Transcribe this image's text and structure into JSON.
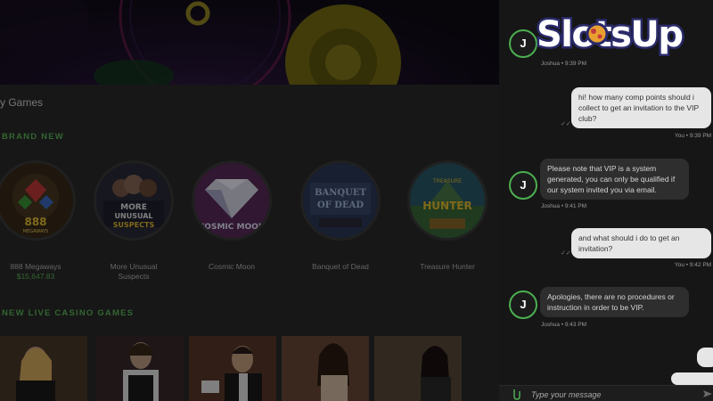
{
  "casino": {
    "section_title": "y Games",
    "brand_new_label": "BRAND NEW",
    "live_label": "NEW LIVE CASINO GAMES",
    "games": [
      {
        "name": "888 Megaways",
        "amount": "$15,647.83",
        "thumb_text": "888 MEGAWAYS"
      },
      {
        "name": "More Unusual\nSuspects",
        "amount": "",
        "thumb_text": "MORE UNUSUAL SUSPECTS"
      },
      {
        "name": "Cosmic Moon",
        "amount": "",
        "thumb_text": "COSMIC MOON"
      },
      {
        "name": "Banquet of Dead",
        "amount": "",
        "thumb_text": "BANQUET OF DEAD"
      },
      {
        "name": "Treasure Hunter",
        "amount": "",
        "thumb_text": "TREASURE HUNTER"
      }
    ]
  },
  "chat": {
    "agent_initial": "J",
    "messages": [
      {
        "from": "agent",
        "meta": "Joshua • 9:39 PM",
        "text": ""
      },
      {
        "from": "user",
        "meta": "You • 9:39 PM",
        "text": "hi! how many comp points should i collect to get an invitation to the VIP club?"
      },
      {
        "from": "agent",
        "meta": "Joshua • 9:41 PM",
        "text": "Please note that VIP is a system generated, you can only be qualified if our system invited you via email."
      },
      {
        "from": "user",
        "meta": "You • 9:42 PM",
        "text": "and what should i do to get an invitation?"
      },
      {
        "from": "agent",
        "meta": "Joshua • 9:43 PM",
        "text": "Apologies, there are no procedures or instruction in order to be VIP."
      }
    ],
    "input_placeholder": "Type your message"
  },
  "logo": {
    "text": "SlotsUp"
  },
  "colors": {
    "accent_green": "#4caf50",
    "bubble_out": "#e6e6e6",
    "bubble_in": "#2e2e2e"
  }
}
